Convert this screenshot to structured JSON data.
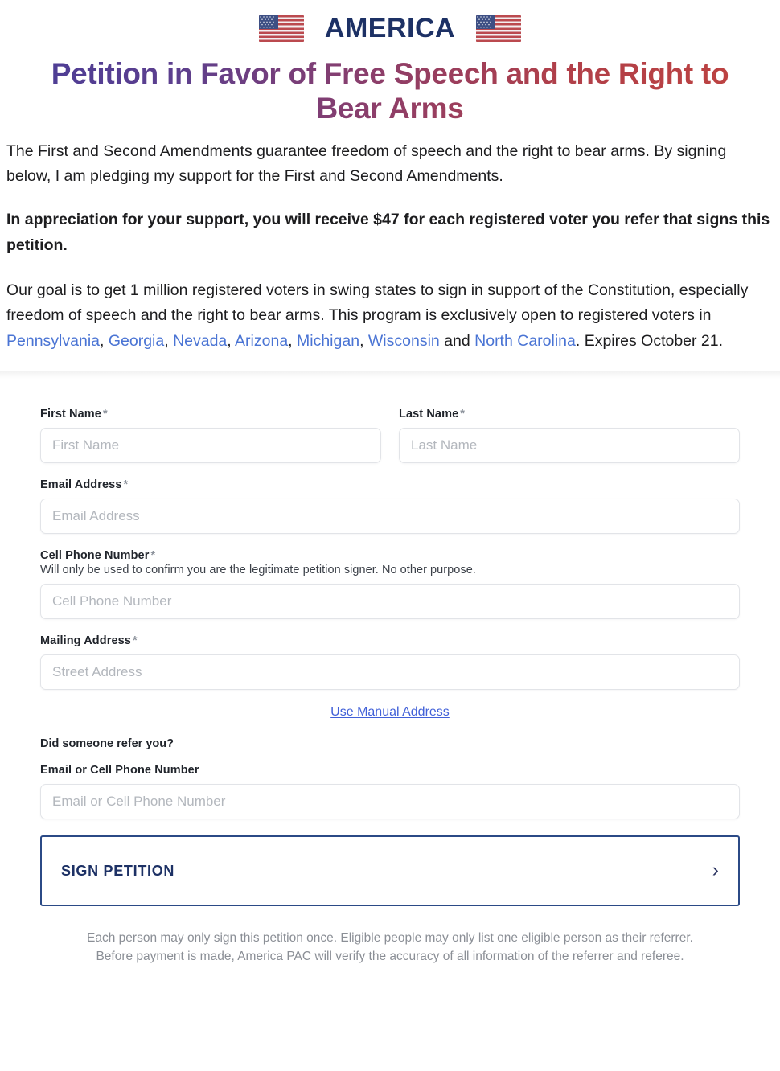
{
  "brand": {
    "wordmark": "AMERICA",
    "flag_left_icon": "us-flag-icon",
    "flag_right_icon": "us-flag-icon",
    "wordmark_color": "#1d3165"
  },
  "intro": {
    "title": "Petition in Favor of Free Speech and the Right to Bear Arms",
    "title_gradient_start": "#4a3d97",
    "title_gradient_end": "#bf4340",
    "paragraph_1": "The First and Second Amendments guarantee freedom of speech and the right to bear arms. By signing below, I am pledging my support for the First and Second Amendments.",
    "paragraph_2_bold": "In appreciation for your support, you will receive $47 for each registered voter you refer that signs this petition.",
    "paragraph_3_pre": "Our goal is to get 1 million registered voters in swing states to sign in support of the Constitution, especially freedom of speech and the right to bear arms. This program is exclusively open to registered voters in ",
    "states": [
      "Pennsylvania",
      "Georgia",
      "Nevada",
      "Arizona",
      "Michigan",
      "Wisconsin",
      "North Carolina"
    ],
    "paragraph_3_conjunction": " and ",
    "paragraph_3_post": ". Expires October 21.",
    "link_color": "#4a74d4"
  },
  "form": {
    "first_name": {
      "label": "First Name",
      "required_mark": "*",
      "placeholder": "First Name",
      "value": ""
    },
    "last_name": {
      "label": "Last Name",
      "required_mark": "*",
      "placeholder": "Last Name",
      "value": ""
    },
    "email": {
      "label": "Email Address",
      "required_mark": "*",
      "placeholder": "Email Address",
      "value": ""
    },
    "cell_phone": {
      "label": "Cell Phone Number",
      "required_mark": "*",
      "helper": "Will only be used to confirm you are the legitimate petition signer. No other purpose.",
      "placeholder": "Cell Phone Number",
      "value": ""
    },
    "mailing_address": {
      "label": "Mailing Address",
      "required_mark": "*",
      "placeholder": "Street Address",
      "value": ""
    },
    "manual_address_link": "Use Manual Address",
    "referral_question": "Did someone refer you?",
    "referral": {
      "label": "Email or Cell Phone Number",
      "placeholder": "Email or Cell Phone Number",
      "value": ""
    }
  },
  "submit": {
    "label": "SIGN PETITION",
    "chevron_icon": "chevron-right-icon",
    "border_color": "#2b4a86",
    "text_color": "#1d3165"
  },
  "footer": {
    "line_1": "Each person may only sign this petition once. Eligible people may only list one eligible person as their referrer.",
    "line_2": "Before payment is made, America PAC will verify the accuracy of all information of the referrer and referee."
  }
}
